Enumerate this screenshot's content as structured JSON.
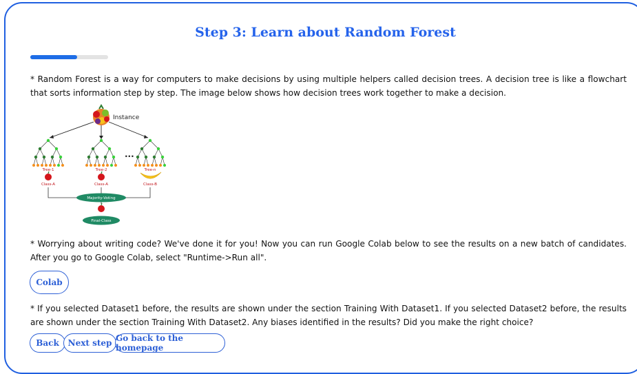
{
  "page": {
    "title": "Step 3: Learn about Random Forest",
    "progress": 0.6
  },
  "content": {
    "intro": "* Random Forest is a way for computers to make decisions by using multiple helpers called decision trees. A decision tree is like a flowchart that sorts information step by step. The image below shows how decision trees work together to make a decision.",
    "colab_text": "* Worrying about writing code? We've done it for you! Now you can run Google Colab below to see the results on a new batch of candidates. After you go to Google Colab, select \"Runtime->Run all\".",
    "dataset_text": "* If you selected Dataset1 before, the results are shown under the section Training With Dataset1. If you selected Dataset2 before, the results are shown under the section Training With Dataset2. Any biases identified in the results? Did you make the right choice?"
  },
  "diagram": {
    "instance_label": "Instance",
    "ellipsis": "...",
    "trees": [
      {
        "name": "Tree-1",
        "class": "Class-A",
        "fruit": "apple-icon"
      },
      {
        "name": "Tree-2",
        "class": "Class-A",
        "fruit": "apple-icon"
      },
      {
        "name": "Tree-n",
        "class": "Class-B",
        "fruit": "banana-icon"
      }
    ],
    "voting_label": "Majority-Voting",
    "final_label": "Final-Class",
    "colors": {
      "root_node": "#2e7d32",
      "leaf_node": "#f4901e",
      "highlight_node": "#39d23a",
      "oval": "#1f8a64",
      "apple": "#d4161c",
      "banana": "#f6c21b"
    }
  },
  "buttons": {
    "colab": "Colab",
    "back": "Back",
    "next": "Next step",
    "home": "Go back to the homepage"
  },
  "colors": {
    "accent": "#2563eb",
    "frame_border": "#1f5fe0"
  }
}
